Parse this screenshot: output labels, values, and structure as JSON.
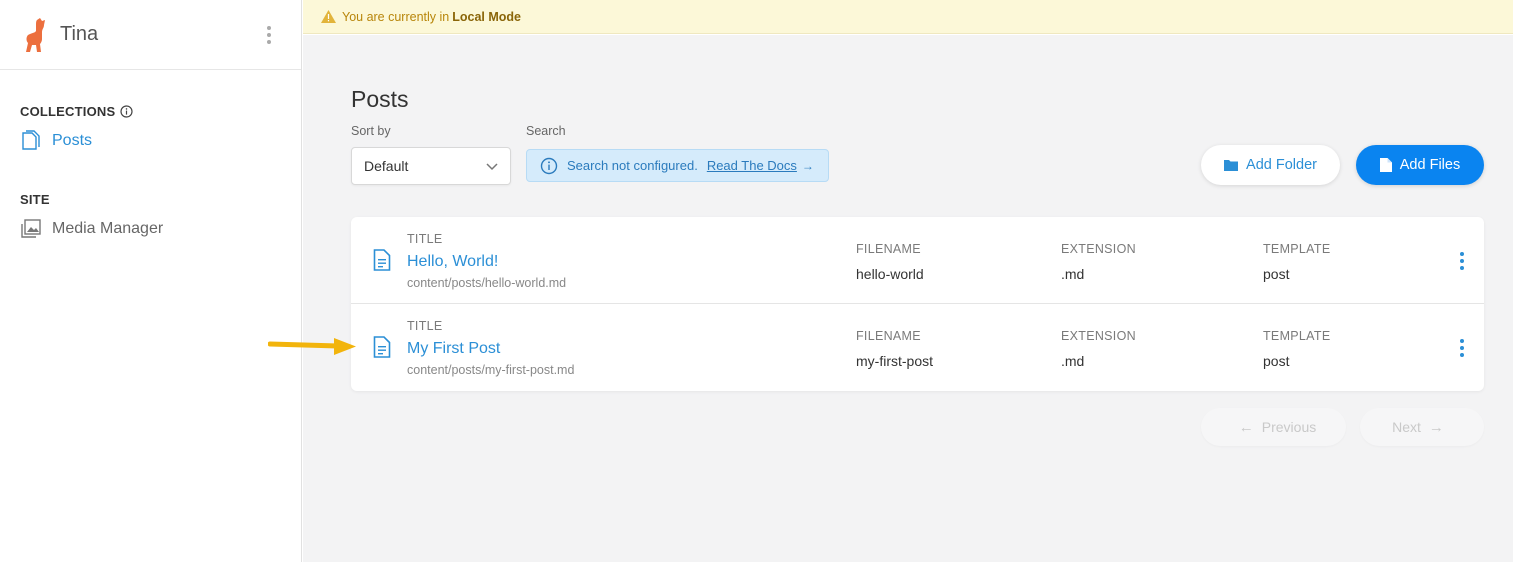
{
  "app": {
    "name": "Tina",
    "logo": "llama-logo-icon"
  },
  "sidebar": {
    "collections_heading": "COLLECTIONS",
    "collections_items": [
      {
        "label": "Posts",
        "icon": "document-icon"
      }
    ],
    "site_heading": "SITE",
    "site_items": [
      {
        "label": "Media Manager",
        "icon": "media-icon"
      }
    ]
  },
  "banner": {
    "text": "You are currently in",
    "mode": "Local Mode",
    "icon": "warning-icon"
  },
  "main": {
    "title": "Posts",
    "sort_label": "Sort by",
    "sort_value": "Default",
    "search_label": "Search",
    "search_message": "Search not configured.",
    "search_link": "Read The Docs",
    "add_folder_label": "Add Folder",
    "add_files_label": "Add Files"
  },
  "table": {
    "headers": {
      "title": "TITLE",
      "filename": "FILENAME",
      "extension": "EXTENSION",
      "template": "TEMPLATE"
    },
    "rows": [
      {
        "title": "Hello, World!",
        "path": "content/posts/hello-world.md",
        "filename": "hello-world",
        "extension": ".md",
        "template": "post"
      },
      {
        "title": "My First Post",
        "path": "content/posts/my-first-post.md",
        "filename": "my-first-post",
        "extension": ".md",
        "template": "post"
      }
    ]
  },
  "pagination": {
    "previous": "Previous",
    "next": "Next"
  },
  "colors": {
    "accent": "#0a84f0",
    "link": "#2b8fd6",
    "banner_bg": "#fcf8d8",
    "logo": "#ec6f3e",
    "annotation": "#f2b40c"
  }
}
